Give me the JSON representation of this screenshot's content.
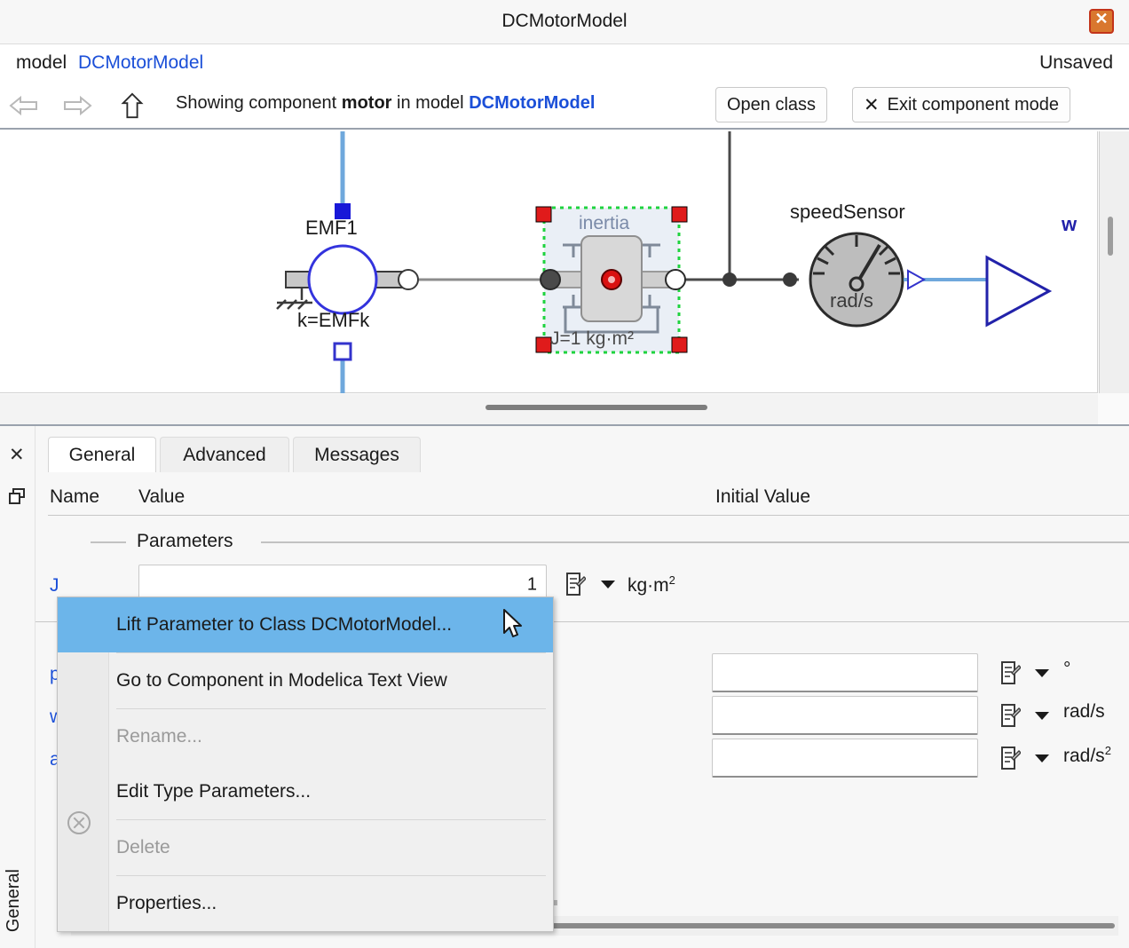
{
  "window": {
    "title": "DCMotorModel",
    "close_icon": "close-icon"
  },
  "model_line": {
    "keyword": "model",
    "name": "DCMotorModel",
    "status": "Unsaved"
  },
  "toolbar": {
    "back_icon": "arrow-left-icon",
    "forward_icon": "arrow-right-icon",
    "up_icon": "arrow-up-icon",
    "showing_prefix": "Showing component",
    "showing_component": "motor",
    "showing_middle": "in model",
    "showing_model": "DCMotorModel",
    "open_class_label": "Open class",
    "exit_mode_label": "Exit component mode",
    "exit_mode_icon": "x-icon"
  },
  "diagram": {
    "components": {
      "emf": {
        "name": "EMF1",
        "parameter": "k=EMFk"
      },
      "inertia": {
        "name": "inertia",
        "parameter": "J=1 kg·m²"
      },
      "speed_sensor": {
        "name": "speedSensor",
        "unit": "rad/s"
      },
      "output_port": {
        "name": "w"
      }
    }
  },
  "panel": {
    "rail": {
      "close_icon": "close-icon",
      "float_icon": "undock-icon",
      "vertical_label": "General"
    },
    "tabs": [
      {
        "label": "General",
        "active": true
      },
      {
        "label": "Advanced",
        "active": false
      },
      {
        "label": "Messages",
        "active": false
      }
    ],
    "columns": {
      "name": "Name",
      "value": "Value",
      "initial_value": "Initial Value"
    },
    "groups": [
      {
        "label": "Parameters"
      }
    ],
    "rows": [
      {
        "name": "J",
        "value": "1",
        "unit_html": "kg·m<sup class=\"sup\">2</sup>",
        "unit_text": "kg·m2"
      },
      {
        "name": "phi",
        "value": "",
        "unit_html": "°",
        "unit_text": "°"
      },
      {
        "name": "w",
        "value": "",
        "unit_html": "rad/s",
        "unit_text": "rad/s"
      },
      {
        "name": "a",
        "value": "",
        "unit_html": "rad/s<sup class=\"sup\">2</sup>",
        "unit_text": "rad/s2"
      }
    ],
    "row_icons": {
      "edit_icon": "edit-note-icon",
      "dropdown_icon": "chevron-down-icon"
    }
  },
  "context_menu": {
    "items": [
      {
        "label": "Lift Parameter to Class DCMotorModel...",
        "highlighted": true,
        "disabled": false
      },
      {
        "label": "Go to Component in Modelica Text View",
        "highlighted": false,
        "disabled": false
      },
      {
        "label": "Rename...",
        "highlighted": false,
        "disabled": true
      },
      {
        "label": "Edit Type Parameters...",
        "highlighted": false,
        "disabled": false
      },
      {
        "label": "Delete",
        "highlighted": false,
        "disabled": true
      },
      {
        "label": "Properties...",
        "highlighted": false,
        "disabled": false
      }
    ],
    "delete_icon": "delete-circle-icon",
    "cursor_icon": "mouse-pointer-icon",
    "highlight_color": "#6cb5ea"
  },
  "colors": {
    "link_blue": "#1b4fd8",
    "close_orange": "#d9772e",
    "selection_green": "#22cc44",
    "handle_red": "#e01b1b"
  }
}
